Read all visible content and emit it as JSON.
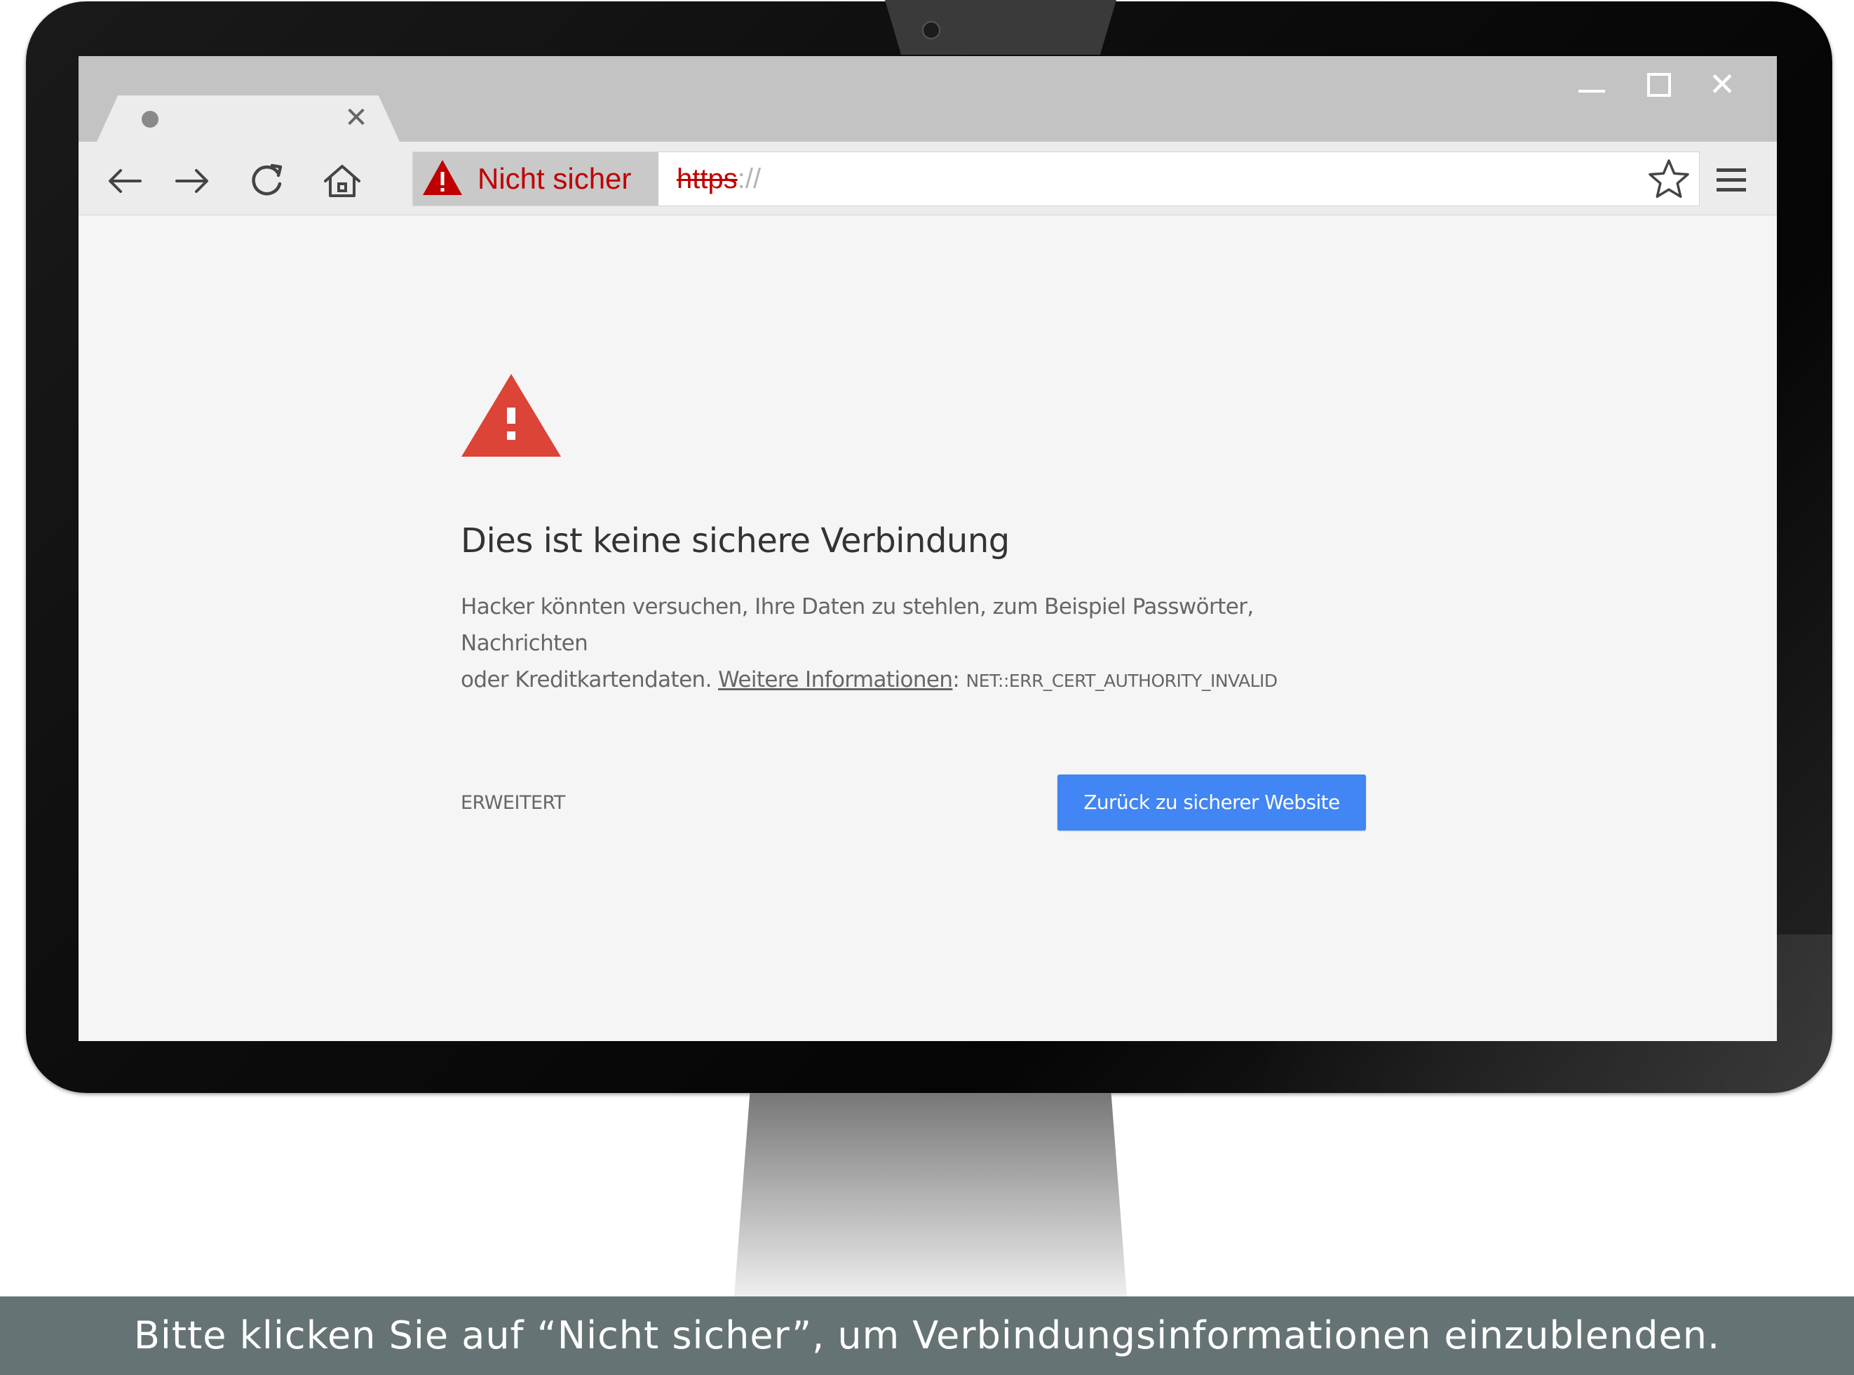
{
  "browser": {
    "security_indicator": "Nicht sicher",
    "url_scheme": "https",
    "url_rest": "://",
    "icons": [
      "back-arrow-icon",
      "forward-arrow-icon",
      "reload-icon",
      "home-icon",
      "warning-triangle-icon",
      "star-icon",
      "hamburger-menu-icon",
      "close-icon",
      "minimize-icon",
      "maximize-icon"
    ]
  },
  "page": {
    "heading": "Dies ist keine sichere Verbindung",
    "body_line1": "Hacker könnten versuchen, Ihre Daten zu stehlen, zum Beispiel Passwörter, Nachrichten",
    "body_line2_prefix": "oder Kreditkartendaten. ",
    "more_info_link": "Weitere Informationen",
    "separator": ": ",
    "error_code": "NET::ERR_CERT_AUTHORITY_INVALID",
    "advanced_label": "ERWEITERT",
    "back_button_label": "Zurück zu sicherer Website"
  },
  "caption": {
    "text": "Bitte klicken Sie auf “Nicht sicher”, um Verbindungsinformationen einzublenden."
  },
  "colors": {
    "warning_red": "#c00000",
    "interstitial_icon_red": "#db4437",
    "primary_blue": "#4285f4",
    "caption_bg": "#667375"
  }
}
